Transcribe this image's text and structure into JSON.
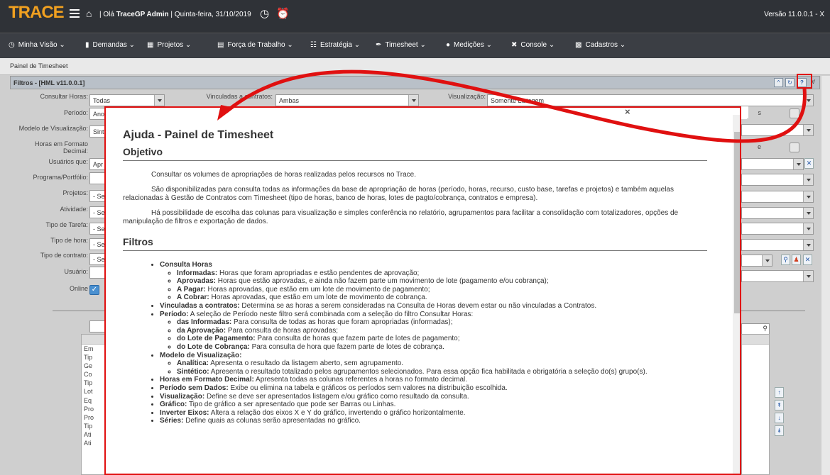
{
  "app": {
    "logo": "TRACE",
    "greeting_prefix": "| Olá ",
    "user": "TraceGP Admin",
    "date": " | Quinta-feira, 31/10/2019",
    "version": "Versão 11.0.0.1 - X"
  },
  "nav": [
    {
      "label": "Minha Visão ⌄",
      "icon": "dashboard-icon"
    },
    {
      "label": "Demandas ⌄",
      "icon": "document-icon"
    },
    {
      "label": "Projetos ⌄",
      "icon": "projects-icon"
    },
    {
      "label": "Força de Trabalho ⌄",
      "icon": "workforce-icon"
    },
    {
      "label": "Estratégia ⌄",
      "icon": "strategy-icon"
    },
    {
      "label": "Timesheet ⌄",
      "icon": "timesheet-icon"
    },
    {
      "label": "Medições ⌄",
      "icon": "measurement-icon"
    },
    {
      "label": "Console ⌄",
      "icon": "console-icon"
    },
    {
      "label": "Cadastros ⌄",
      "icon": "register-icon"
    }
  ],
  "tab": "Painel de Timesheet",
  "filters": {
    "title": "Filtros - [HML v11.0.0.1]",
    "consultar_label": "Consultar Horas:",
    "consultar_value": "Todas",
    "vinculadas_label": "Vinculadas a contratos:",
    "vinculadas_value": "Ambas",
    "visualizacao_label": "Visualização:",
    "visualizacao_value": "Somente Listagem",
    "periodo_label": "Período:",
    "periodo_value": "Ano",
    "modelo_label": "Modelo de Visualização:",
    "modelo_value": "Sint",
    "horas_label": "Horas em Formato Decimal:",
    "usuarios_label": "Usuários que:",
    "usuarios_value": "Apr",
    "programa_label": "Programa/Portfólio:",
    "projetos_label": "Projetos:",
    "atividade_label": "Atividade:",
    "tipo_tarefa_label": "Tipo de Tarefa:",
    "tipo_hora_label": "Tipo de hora:",
    "tipo_contrato_label": "Tipo de contrato:",
    "usuario_label": "Usuário:",
    "online_label": "Online",
    "sel_value": "- Se",
    "trunc_s": "s",
    "trunc_e": "e"
  },
  "modal": {
    "close": "×",
    "title": "Ajuda - Painel de Timesheet",
    "objetivo": "Objetivo",
    "p1": "Consultar os volumes de apropriações de horas realizadas pelos recursos no Trace.",
    "p2": "São disponibilizadas para consulta todas as informações da base de apropriação de horas (período, horas, recurso, custo base, tarefas e projetos) e também aquelas relacionadas à Gestão de Contratos com Timesheet (tipo de horas, banco de horas, lotes de pagto/cobrança, contratos e empresa).",
    "p3": "Há possibilidade de escolha das colunas para visualização e simples conferência no relatório, agrupamentos para facilitar a consolidação com totalizadores, opções de manipulação de filtros e exportação de dados.",
    "filtros": "Filtros",
    "items": [
      {
        "b": "Consulta Horas",
        "t": "",
        "sub": [
          {
            "b": "Informadas:",
            "t": " Horas que foram apropriadas e estão pendentes de aprovação;"
          },
          {
            "b": "Aprovadas:",
            "t": " Horas que estão aprovadas, e ainda não fazem parte um movimento de lote (pagamento e/ou cobrança);"
          },
          {
            "b": "A Pagar:",
            "t": " Horas aprovadas, que estão em um lote de movimento de pagamento;"
          },
          {
            "b": "A Cobrar:",
            "t": " Horas aprovadas, que estão em um lote de movimento de cobrança."
          }
        ]
      },
      {
        "b": "Vinculadas a contratos:",
        "t": " Determina se as horas a serem consideradas na Consulta de Horas devem estar ou não vinculadas a Contratos.",
        "sub": []
      },
      {
        "b": "Período:",
        "t": " A seleção de Período neste filtro será combinada com a seleção do filtro Consultar Horas:",
        "sub": [
          {
            "b": "das Informadas:",
            "t": " Para consulta de todas as horas que foram apropriadas (informadas);"
          },
          {
            "b": "da Aprovação:",
            "t": " Para consulta de horas aprovadas;"
          },
          {
            "b": "do Lote de Pagamento:",
            "t": " Para consulta de horas que fazem parte de lotes de pagamento;"
          },
          {
            "b": "do Lote de Cobrança:",
            "t": " Para consulta de hora que fazem parte de lotes de cobrança."
          }
        ]
      },
      {
        "b": "Modelo de Visualização:",
        "t": "",
        "sub": [
          {
            "b": "Analítica:",
            "t": " Apresenta o resultado da listagem aberto, sem agrupamento."
          },
          {
            "b": "Sintético:",
            "t": " Apresenta o resultado totalizado pelos agrupamentos selecionados. Para essa opção fica habilitada e obrigatória a seleção do(s) grupo(s)."
          }
        ]
      },
      {
        "b": "Horas em Formato Decimal:",
        "t": " Apresenta todas as colunas referentes a horas no formato decimal.",
        "sub": []
      },
      {
        "b": "Período sem Dados:",
        "t": " Exibe ou elimina na tabela e gráficos os períodos sem valores na distribuição escolhida.",
        "sub": []
      },
      {
        "b": "Visualização:",
        "t": " Define se deve ser apresentados listagem e/ou gráfico como resultado da consulta.",
        "sub": []
      },
      {
        "b": "Gráfico:",
        "t": " Tipo de gráfico a ser apresentado que pode ser Barras ou Linhas.",
        "sub": []
      },
      {
        "b": "Inverter Eixos:",
        "t": " Altera a relação dos eixos X e Y do gráfico, invertendo o gráfico horizontalmente.",
        "sub": []
      },
      {
        "b": "Séries:",
        "t": " Define quais as colunas serão apresentadas no gráfico.",
        "sub": []
      }
    ]
  },
  "left_list": [
    "Em",
    "Tip",
    "Ge",
    "Co",
    "Tip",
    "Lot",
    "Eq",
    "Pro",
    "Pro",
    "Tip",
    "Ati",
    "Ati"
  ],
  "accent_color": "#e01010"
}
